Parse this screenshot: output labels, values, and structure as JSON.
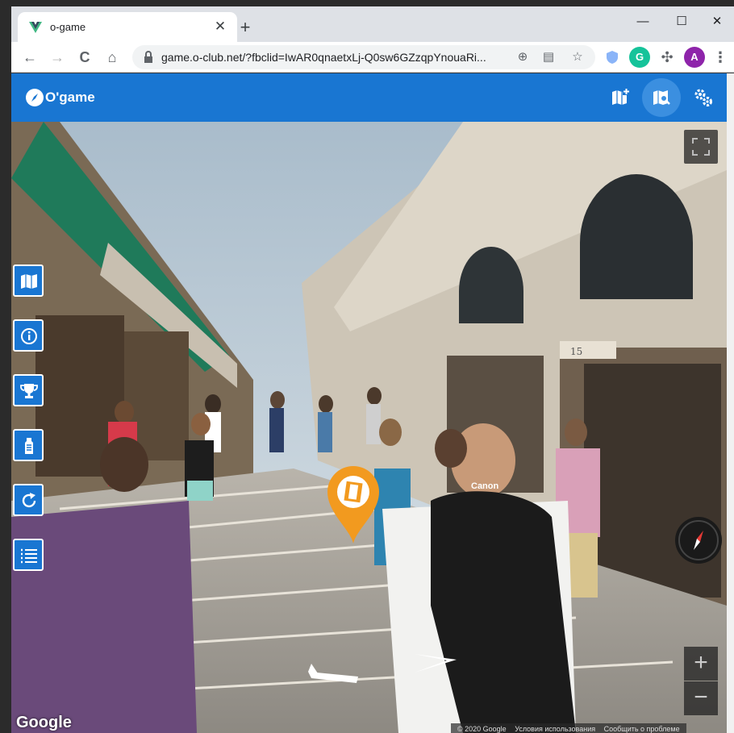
{
  "browser": {
    "tab_title": "o-game",
    "new_tab_glyph": "+",
    "tab_close_glyph": "✕",
    "url": "game.o-club.net/?fbclid=IwAR0qnaetxLj-Q0sw6GZzqpYnouaRi...",
    "window_controls": {
      "minimize": "—",
      "maximize": "☐",
      "close": "✕"
    },
    "nav": {
      "back": "←",
      "forward": "→",
      "reload": "C",
      "home": "⌂"
    },
    "extension_avatar": "A",
    "extension_grammarly": "G"
  },
  "app": {
    "brand": "O'game",
    "accent": "#1976d2",
    "header_buttons": [
      "add-map-icon",
      "map-search-icon",
      "settings-icon"
    ],
    "side_buttons": [
      "map-icon",
      "info-icon",
      "trophy-icon",
      "ranking-icon",
      "refresh-icon",
      "list-icon"
    ]
  },
  "streetview": {
    "attribution_logo": "Google",
    "copyright": "© 2020 Google",
    "terms": "Условия использования",
    "report": "Сообщить о проблеме",
    "zoom_in": "+",
    "zoom_out": "−",
    "shop_number": "15",
    "bag_brand": "Canon"
  }
}
